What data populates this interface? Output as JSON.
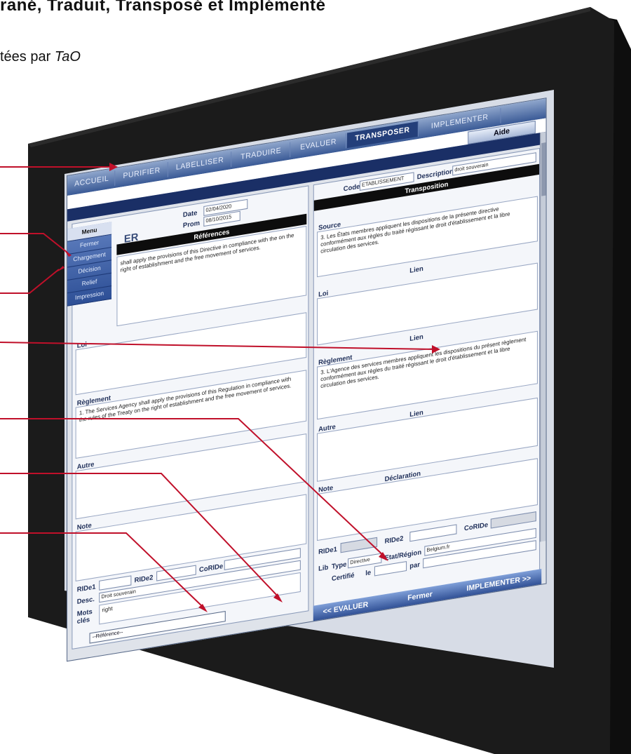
{
  "heading": {
    "line1_a": "rané, Traduit, ",
    "line1_b": "Transposé et Implémenté",
    "line2_a": "tées par ",
    "line2_b": "TaO"
  },
  "tabs": [
    "ACCUEIL",
    "PURIFIER",
    "LABELLISER",
    "TRADUIRE",
    "EVALUER",
    "TRANSPOSER",
    "IMPLEMENTER"
  ],
  "active_tab": "TRANSPOSER",
  "aide_label": "Aide",
  "menu": {
    "title": "Menu",
    "items": [
      "Fermer",
      "Chargement",
      "Décision",
      "Relief",
      "Impression"
    ]
  },
  "left": {
    "field_label_1": "Date",
    "field_value_1": "02/04/2020",
    "field_label_2": "Prom",
    "field_value_2": "08/10/2015",
    "title_partial": "ER",
    "references_header": "Références",
    "ref_text": "shall apply the provisions of this Directive in compliance with the on the right of establishment and the free movement of services.",
    "loi_label": "Loi",
    "reglement_label": "Règlement",
    "reglement_text": "1. The Services Agency shall apply the provisions of this Regulation in compliance with the rules of the Treaty on the right of establishment and the free movement of services.",
    "autre_label": "Autre",
    "note_label": "Note",
    "ridel_label": "RIDe1",
    "ride2_label": "RIDe2",
    "corde_label": "CoRIDe",
    "desc_label": "Desc.",
    "desc_value": "Droit souverain",
    "mots_label": "Mots clés",
    "mots_value": "right",
    "reference_select": "--Référence--"
  },
  "right": {
    "code_label": "Code",
    "code_value": "ETABLISSEMENT",
    "description_label": "Description",
    "description_value": "droit souverain",
    "transposition_header": "Transposition",
    "source_label": "Source",
    "source_text": "3. Les États membres appliquent les dispositions de la présente directive conformément aux règles du traité régissant le droit d'établissement et la libre circulation des services.",
    "loi_label": "Loi",
    "lien_label": "Lien",
    "reglement_label": "Règlement",
    "reglement_text": "3. L'Agence des services membres appliquent les dispositions du présent règlement conformément aux règles du traité régissant le droit d'établissement et la libre circulation des services.",
    "autre_label": "Autre",
    "note_label": "Note",
    "declaration_label": "Déclaration",
    "ride1_label": "RIDe1",
    "ride2_label": "RIDe2",
    "corde_label": "CoRIDe",
    "type_label": "Type",
    "type_value": "Directive",
    "etat_label": "Etat/Région",
    "etat_value": "Belgium.fr",
    "certifie_label": "Certifié",
    "le_label": "le",
    "par_label": "par",
    "lib_label": "Lib"
  },
  "buttons": {
    "evaluer": "<< EVALUER",
    "fermer": "Fermer",
    "implementer": "IMPLEMENTER >>"
  },
  "colors": {
    "bezel": "#1a1a1a",
    "accent_red": "#c0102a",
    "nav_blue": "#2a4a90"
  }
}
